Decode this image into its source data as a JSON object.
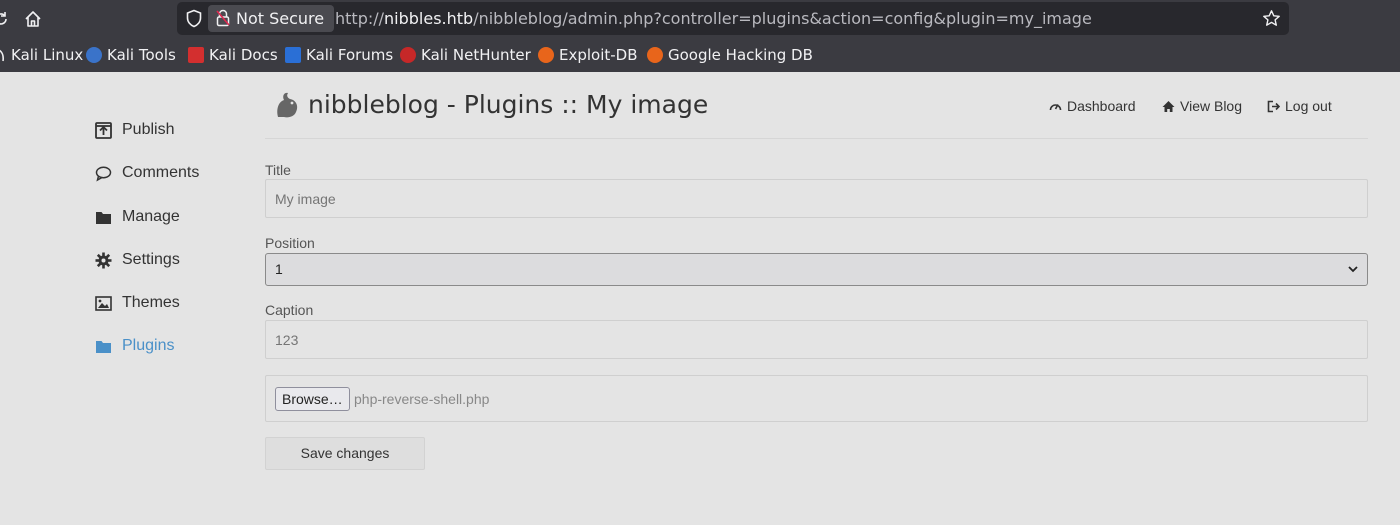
{
  "browser": {
    "not_secure_label": "Not Secure",
    "url_prefix": "http://",
    "url_host": "nibbles.htb",
    "url_path": "/nibbleblog/admin.php?controller=plugins&action=config&plugin=my_image",
    "bookmarks": [
      {
        "label": "Kali Linux",
        "icon": "kali-icon"
      },
      {
        "label": "Kali Tools",
        "icon": "kali-tools-icon"
      },
      {
        "label": "Kali Docs",
        "icon": "kali-docs-icon"
      },
      {
        "label": "Kali Forums",
        "icon": "kali-forums-icon"
      },
      {
        "label": "Kali NetHunter",
        "icon": "nethunter-icon"
      },
      {
        "label": "Exploit-DB",
        "icon": "exploit-db-icon"
      },
      {
        "label": "Google Hacking DB",
        "icon": "ghdb-icon"
      }
    ]
  },
  "header": {
    "title": "nibbleblog - Plugins :: My image",
    "links": [
      {
        "label": "Dashboard",
        "icon": "dashboard-icon"
      },
      {
        "label": "View Blog",
        "icon": "home-icon"
      },
      {
        "label": "Log out",
        "icon": "logout-icon"
      }
    ]
  },
  "sidebar": {
    "items": [
      {
        "label": "Publish",
        "icon": "publish-icon",
        "active": false
      },
      {
        "label": "Comments",
        "icon": "comments-icon",
        "active": false
      },
      {
        "label": "Manage",
        "icon": "folder-icon",
        "active": false
      },
      {
        "label": "Settings",
        "icon": "gear-icon",
        "active": false
      },
      {
        "label": "Themes",
        "icon": "image-icon",
        "active": false
      },
      {
        "label": "Plugins",
        "icon": "folder-open-icon",
        "active": true
      }
    ]
  },
  "form": {
    "title_label": "Title",
    "title_value": "My image",
    "position_label": "Position",
    "position_value": "1",
    "caption_label": "Caption",
    "caption_value": "123",
    "browse_label": "Browse…",
    "file_name": "php-reverse-shell.php",
    "save_label": "Save changes"
  },
  "colors": {
    "chrome": "#3b3b41",
    "urlbar": "#28282d",
    "page_bg": "#e4e4e4",
    "active_link": "#4a90c8"
  }
}
